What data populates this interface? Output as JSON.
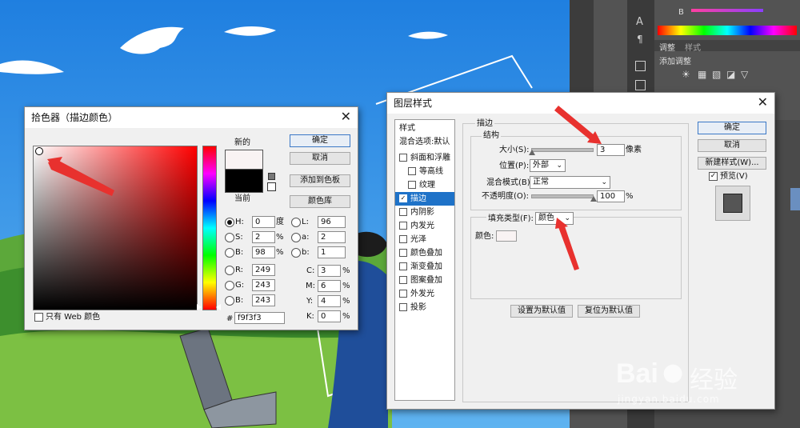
{
  "color_picker": {
    "title": "拾色器（描边颜色）",
    "new_label": "新的",
    "current_label": "当前",
    "new_color": "#f9f3f3",
    "current_color": "#000000",
    "buttons": {
      "ok": "确定",
      "cancel": "取消",
      "add_to_swatches": "添加到色板",
      "color_libraries": "颜色库"
    },
    "fields": {
      "H": {
        "label": "H:",
        "value": "0",
        "unit": "度"
      },
      "S": {
        "label": "S:",
        "value": "2",
        "unit": "%"
      },
      "B": {
        "label": "B:",
        "value": "98",
        "unit": "%"
      },
      "R": {
        "label": "R:",
        "value": "249"
      },
      "G": {
        "label": "G:",
        "value": "243"
      },
      "Bl": {
        "label": "B:",
        "value": "243"
      },
      "L": {
        "label": "L:",
        "value": "96"
      },
      "a": {
        "label": "a:",
        "value": "2"
      },
      "b": {
        "label": "b:",
        "value": "1"
      },
      "C": {
        "label": "C:",
        "value": "3",
        "unit": "%"
      },
      "M": {
        "label": "M:",
        "value": "6",
        "unit": "%"
      },
      "Y": {
        "label": "Y:",
        "value": "4",
        "unit": "%"
      },
      "K": {
        "label": "K:",
        "value": "0",
        "unit": "%"
      }
    },
    "hex_label": "#",
    "hex_value": "f9f3f3",
    "web_only_label": "只有 Web 颜色"
  },
  "layer_style": {
    "title": "图层样式",
    "styles_header": "样式",
    "blending_default": "混合选项:默认",
    "items": [
      {
        "label": "斜面和浮雕",
        "checked": false,
        "indent": false
      },
      {
        "label": "等高线",
        "checked": false,
        "indent": true
      },
      {
        "label": "纹理",
        "checked": false,
        "indent": true
      },
      {
        "label": "描边",
        "checked": true,
        "indent": false,
        "active": true
      },
      {
        "label": "内阴影",
        "checked": false,
        "indent": false
      },
      {
        "label": "内发光",
        "checked": false,
        "indent": false
      },
      {
        "label": "光泽",
        "checked": false,
        "indent": false
      },
      {
        "label": "颜色叠加",
        "checked": false,
        "indent": false
      },
      {
        "label": "渐变叠加",
        "checked": false,
        "indent": false
      },
      {
        "label": "图案叠加",
        "checked": false,
        "indent": false
      },
      {
        "label": "外发光",
        "checked": false,
        "indent": false
      },
      {
        "label": "投影",
        "checked": false,
        "indent": false
      }
    ],
    "section_title": "描边",
    "structure_title": "结构",
    "size_label": "大小(S):",
    "size_value": "3",
    "size_unit": "像素",
    "position_label": "位置(P):",
    "position_value": "外部",
    "blend_mode_label": "混合模式(B):",
    "blend_mode_value": "正常",
    "opacity_label": "不透明度(O):",
    "opacity_value": "100",
    "opacity_unit": "%",
    "fill_type_label": "填充类型(F):",
    "fill_type_value": "颜色",
    "color_label": "颜色:",
    "stroke_color": "#f9f3f3",
    "make_default": "设置为默认值",
    "reset_default": "复位为默认值",
    "ok": "确定",
    "cancel": "取消",
    "new_style": "新建样式(W)...",
    "preview_label": "预览(V)",
    "preview_checked": true
  },
  "ps_panel": {
    "tab_adjust": "调整",
    "tab_style": "样式",
    "add_adjustment": "添加调整",
    "b_label": "B"
  },
  "watermark": {
    "brand": "Bai",
    "brand2": "经验",
    "url": "jingyan.baidu.com"
  }
}
